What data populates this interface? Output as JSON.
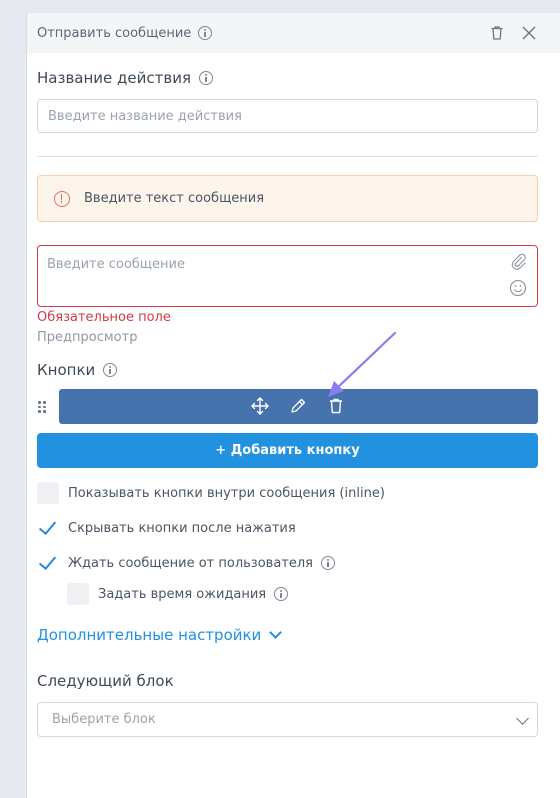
{
  "header": {
    "title": "Отправить сообщение",
    "info_icon": "info-icon",
    "delete_icon": "trash-icon",
    "close_icon": "close-icon"
  },
  "action_name": {
    "label": "Название действия",
    "placeholder": "Введите название действия",
    "value": ""
  },
  "warning": {
    "icon": "alert-circle-icon",
    "text": "Введите текст сообщения"
  },
  "message": {
    "placeholder": "Введите сообщение",
    "value": "",
    "attach_icon": "paperclip-icon",
    "emoji_icon": "smile-icon",
    "error": "Обязательное поле",
    "preview_link": "Предпросмотр"
  },
  "buttons": {
    "label": "Кнопки",
    "bar_icons": [
      "move-icon",
      "edit-icon",
      "trash-icon"
    ],
    "add_label": "+ Добавить кнопку"
  },
  "options": [
    {
      "label": "Показывать кнопки внутри сообщения (inline)",
      "checked": false
    },
    {
      "label": "Скрывать кнопки после нажатия",
      "checked": true
    },
    {
      "label": "Ждать сообщение от пользователя",
      "checked": true
    },
    {
      "label": "Задать время ожидания",
      "checked": false
    }
  ],
  "advanced": {
    "label": "Дополнительные настройки"
  },
  "next_block": {
    "label": "Следующий блок",
    "placeholder": "Выберите блок"
  },
  "colors": {
    "accent": "#2191e0",
    "button_bar": "#4673ad",
    "error": "#d33a4a",
    "warning_bg": "#fdf4ec",
    "arrow": "#8b7cf0"
  }
}
